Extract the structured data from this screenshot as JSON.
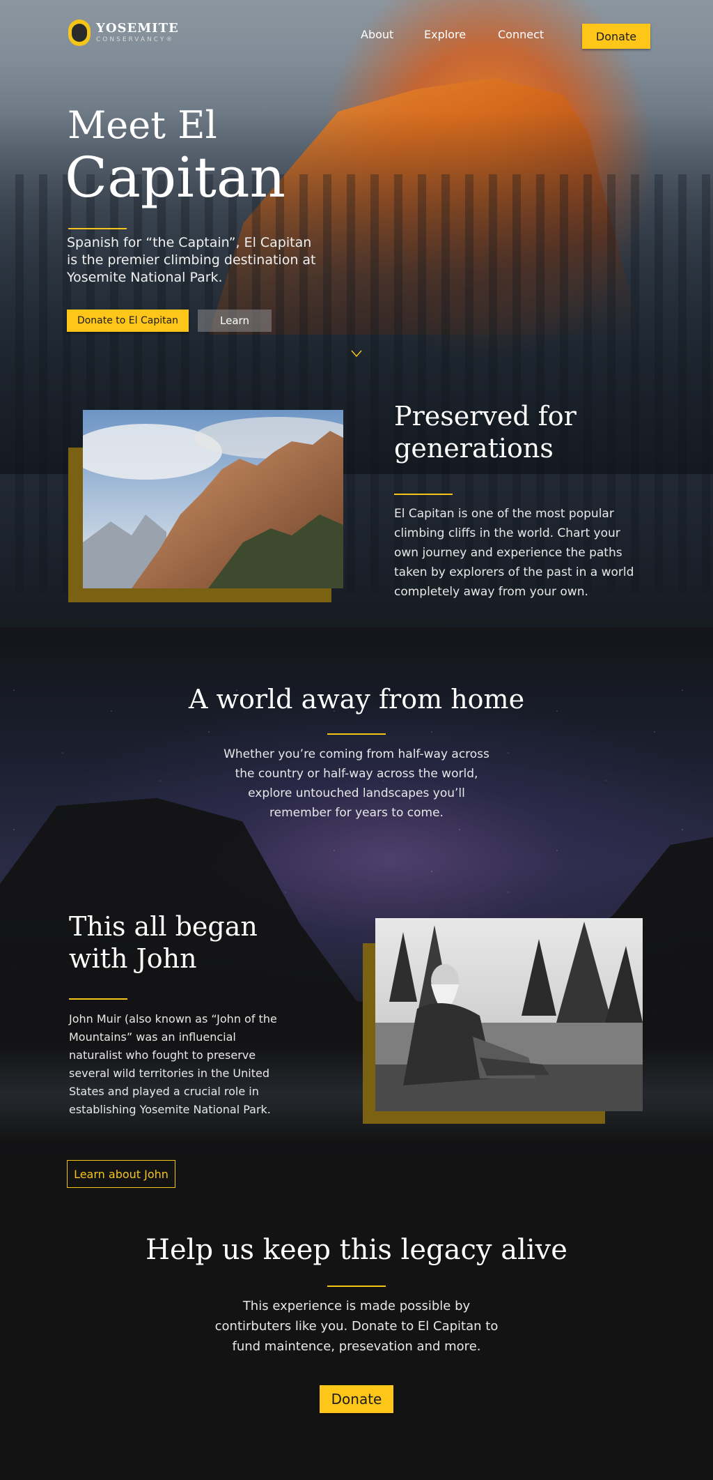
{
  "header": {
    "logo_title": "YOSEMITE",
    "logo_subtitle": "CONSERVANCY®",
    "nav": [
      "About",
      "Explore",
      "Connect"
    ],
    "donate_label": "Donate"
  },
  "hero": {
    "title_line1": "Meet El",
    "title_line2": "Capitan",
    "description": "Spanish for “the Captain”, El Capitan is the premier climbing destination at Yosemite National Park.",
    "donate_button": "Donate to El Capitan",
    "learn_button": "Learn"
  },
  "preserved": {
    "title": "Preserved for generations",
    "body": "El Capitan is one of the most popular climbing cliffs in the world. Chart your own journey and experience the paths taken by explorers of the past in a world completely away from your own."
  },
  "world": {
    "title": "A world away from home",
    "body": "Whether you’re coming from half-way across the country or half-way across the world, explore untouched landscapes you’ll remember for years to come."
  },
  "john": {
    "title": "This all began with John",
    "body": "John Muir (also known as “John of the Mountains” was an influencial naturalist who fought to preserve several wild territories in the United States and played a crucial role in establishing Yosemite National Park.",
    "button": "Learn about John"
  },
  "legacy": {
    "title": "Help us keep this legacy alive",
    "body": "This experience is made possible by contirbuters like you. Donate to El Capitan to fund maintence, presevation and more.",
    "donate_button": "Donate"
  },
  "colors": {
    "accent": "#ffc61a",
    "frame": "#7a6212",
    "background": "#131313"
  }
}
